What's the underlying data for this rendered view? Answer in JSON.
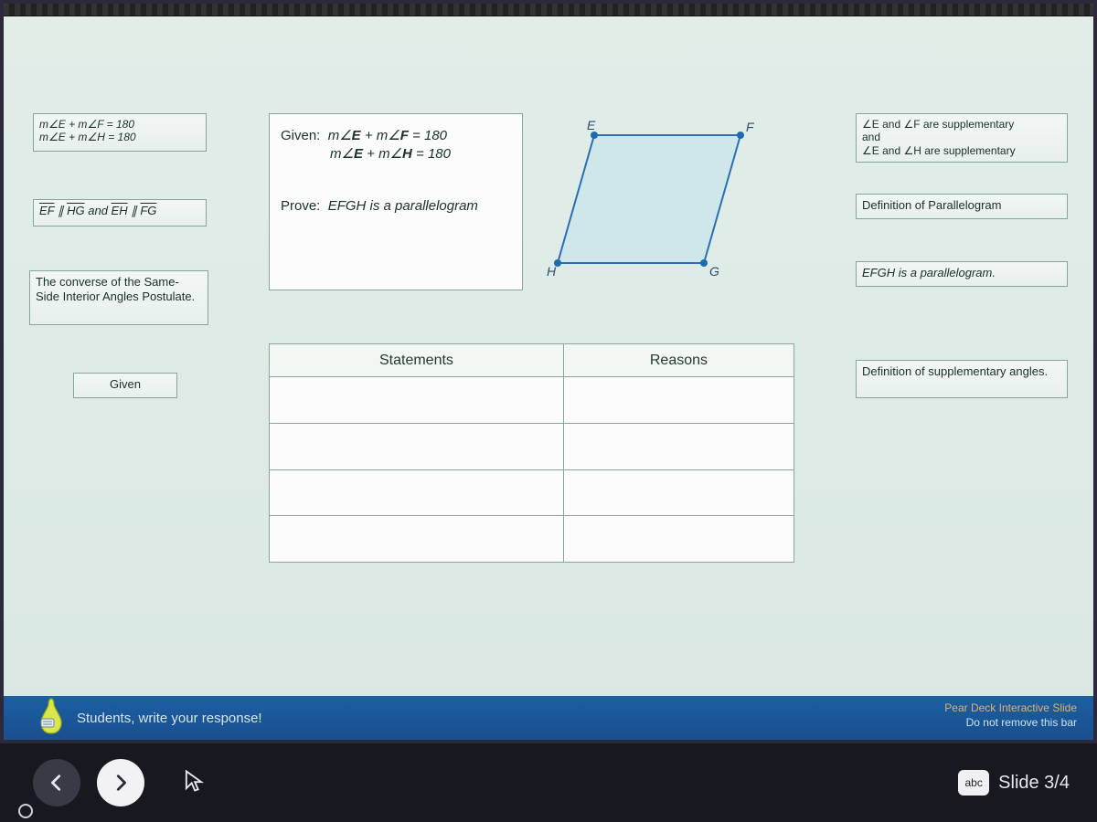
{
  "tiles_left": [
    {
      "l1": "m∠E + m∠F = 180",
      "l2": "m∠E + m∠H = 180"
    },
    {
      "text_html": "EF ∥ HG and EH ∥ FG"
    },
    {
      "text": "The converse of the Same-Side Interior Angles Postulate."
    },
    {
      "text": "Given"
    }
  ],
  "tiles_right": [
    {
      "l1": "∠E and ∠F are supplementary",
      "l2": "and",
      "l3": "∠E and ∠H are supplementary"
    },
    {
      "text": "Definition of Parallelogram"
    },
    {
      "text": "EFGH is a parallelogram."
    },
    {
      "text": "Definition of supplementary angles."
    }
  ],
  "problem": {
    "given_label": "Given:",
    "given1": "m∠E + m∠F = 180",
    "given2": "m∠E + m∠H = 180",
    "prove_label": "Prove:",
    "prove": "EFGH is a parallelogram"
  },
  "figure": {
    "labels": {
      "E": "E",
      "F": "F",
      "G": "G",
      "H": "H"
    }
  },
  "proof_headers": {
    "statements": "Statements",
    "reasons": "Reasons"
  },
  "proof_rows": 4,
  "pear_banner": {
    "prompt": "Students, write your response!",
    "brand_line1": "Pear Deck Interactive Slide",
    "brand_line2": "Do not remove this bar"
  },
  "controls": {
    "abc_label": "abc",
    "slide_text": "Slide 3/4"
  }
}
